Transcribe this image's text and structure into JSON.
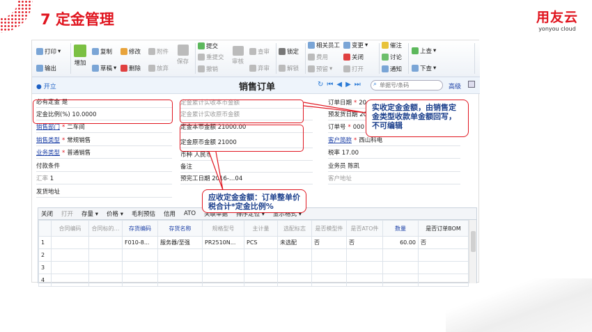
{
  "slide": {
    "title": "7  定金管理",
    "logo_cn": "用友云",
    "logo_en": "yonyou cloud"
  },
  "toolbar": {
    "print": "打印",
    "export": "输出",
    "add": "增加",
    "copy": "复制",
    "draft": "草稿",
    "edit": "修改",
    "delete": "删除",
    "attach": "附件",
    "abandon": "放弃",
    "save": "保存",
    "submit": "提交",
    "resubmit": "重提交",
    "withdraw": "撤销",
    "approve": "审核",
    "check": "查审",
    "reject": "弃审",
    "lock": "锁定",
    "unlock": "解锁",
    "related": "相关员工",
    "expense": "费用",
    "reserve": "预留",
    "change": "变更",
    "close": "关闭",
    "open": "打开",
    "remind": "催注",
    "discuss": "讨论",
    "notify": "通知",
    "up": "上查",
    "down": "下查"
  },
  "bar": {
    "status": "开立",
    "doc_title": "销售订单",
    "search_placeholder": "单据号/条码",
    "advanced": "高级"
  },
  "form": {
    "left": [
      {
        "label": "必有定金",
        "value": "是"
      },
      {
        "label": "定金比例(%)",
        "value": "10.0000"
      },
      {
        "label": "销售部门",
        "value": "二车间",
        "link": true,
        "req": true
      },
      {
        "label": "销售类型",
        "value": "常规销售",
        "link": true,
        "req": true
      },
      {
        "label": "业务类型",
        "value": "普通销售",
        "link": true,
        "req": true
      },
      {
        "label": "付款条件",
        "value": ""
      },
      {
        "label": "汇率",
        "value": "1",
        "gray": true
      },
      {
        "label": "发货地址",
        "value": ""
      }
    ],
    "mid": [
      {
        "label": "定金累计实收本币金额",
        "value": "",
        "gray": true
      },
      {
        "label": "定金累计实收原币金额",
        "value": "",
        "gray": true
      },
      {
        "label": "定金本币金额",
        "value": "21000.00"
      },
      {
        "label": "定金原币金额",
        "value": "21000"
      },
      {
        "label": "币种",
        "value": "人民币"
      },
      {
        "label": "备注",
        "value": ""
      },
      {
        "label": "预完工日期",
        "value": "2016-…04"
      }
    ],
    "right": [
      {
        "label": "订单日期",
        "value": "20",
        "req": true
      },
      {
        "label": "预发货日期",
        "value": "20"
      },
      {
        "label": "订单号",
        "value": "000",
        "req": true
      },
      {
        "label": "客户简称",
        "value": "西山科电",
        "link": true,
        "req": true
      },
      {
        "label": "税率",
        "value": "17.00"
      },
      {
        "label": "业务员",
        "value": "陈凯"
      },
      {
        "label": "客户地址",
        "value": "",
        "gray": true
      }
    ]
  },
  "callouts": {
    "actual": "实收定金金额，由销售定金类型收款单金额回写，不可编辑",
    "receivable": "应收定金金额：订单整单价税合计*定金比例%"
  },
  "grid": {
    "toolbar": [
      "关闭",
      "打开",
      "存量 ▾",
      "价格 ▾",
      "毛利预估",
      "信用",
      "ATO",
      "关联单据",
      "排序定位 ▾",
      "显示格式 ▾"
    ],
    "columns": [
      "",
      "合同编码",
      "合同标的…",
      "存货编码",
      "存货名称",
      "规格型号",
      "主计量",
      "选配标志",
      "是否模型件",
      "是否ATO件",
      "数量",
      "是否订单BOM"
    ],
    "rows": [
      [
        "1",
        "",
        "",
        "F010-8...",
        "服务器/至强",
        "PR2510N...",
        "PCS",
        "未选配",
        "否",
        "否",
        "60.00",
        "否"
      ],
      [
        "2",
        "",
        "",
        "",
        "",
        "",
        "",
        "",
        "",
        "",
        "",
        ""
      ],
      [
        "3",
        "",
        "",
        "",
        "",
        "",
        "",
        "",
        "",
        "",
        "",
        ""
      ],
      [
        "4",
        "",
        "",
        "",
        "",
        "",
        "",
        "",
        "",
        "",
        "",
        ""
      ]
    ]
  },
  "colors": {
    "accent": "#e0141e",
    "link": "#1b3fa6",
    "callout_text": "#1b3f8c"
  }
}
